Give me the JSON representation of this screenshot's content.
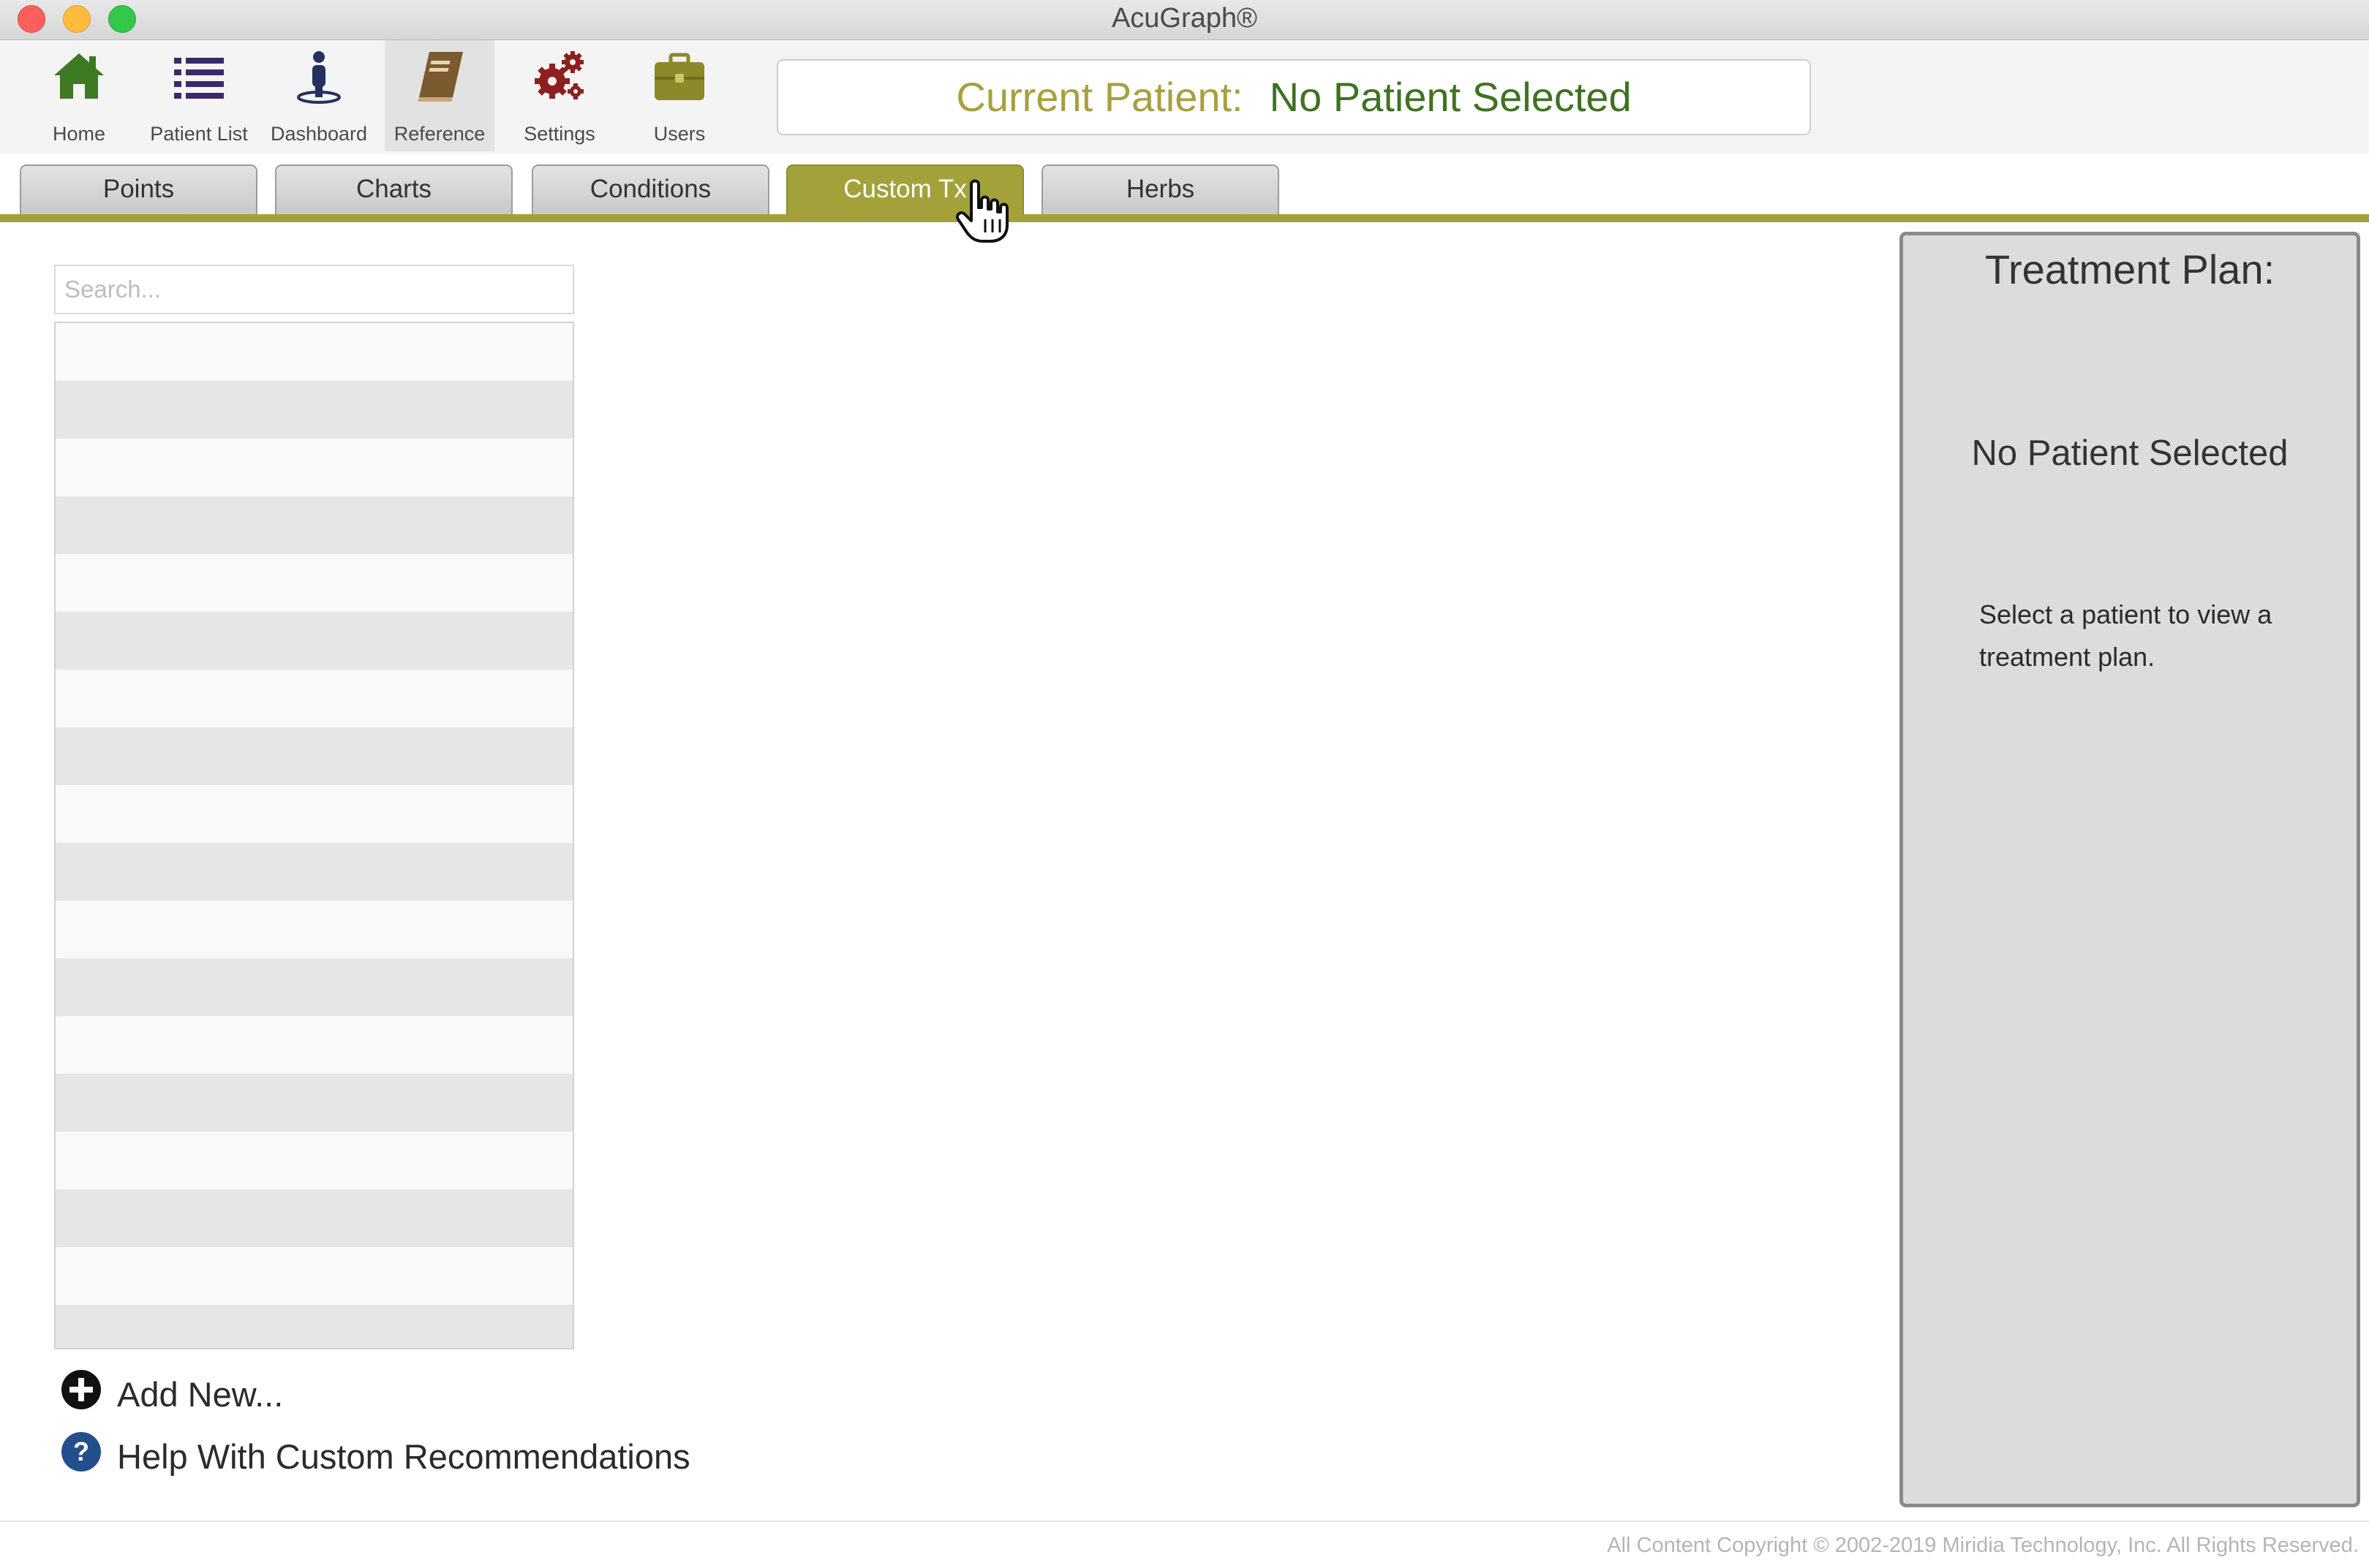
{
  "window": {
    "title": "AcuGraph®"
  },
  "toolbar": {
    "items": [
      {
        "label": "Home",
        "icon": "home-icon",
        "color": "#3d7a22"
      },
      {
        "label": "Patient List",
        "icon": "list-icon",
        "color": "#3b2a6b"
      },
      {
        "label": "Dashboard",
        "icon": "person-icon",
        "color": "#22315f"
      },
      {
        "label": "Reference",
        "icon": "book-icon",
        "color": "#7a5a2e",
        "active": true
      },
      {
        "label": "Settings",
        "icon": "gears-icon",
        "color": "#8e1f1f"
      },
      {
        "label": "Users",
        "icon": "briefcase-icon",
        "color": "#8a8a2a"
      }
    ]
  },
  "current_patient": {
    "label": "Current Patient:",
    "value": "No Patient Selected"
  },
  "tabs": [
    {
      "label": "Points",
      "active": false
    },
    {
      "label": "Charts",
      "active": false
    },
    {
      "label": "Conditions",
      "active": false
    },
    {
      "label": "Custom Tx",
      "active": true
    },
    {
      "label": "Herbs",
      "active": false
    }
  ],
  "search": {
    "placeholder": "Search...",
    "value": ""
  },
  "actions": {
    "add_new": "Add New...",
    "help": "Help With Custom Recommendations"
  },
  "treatment_plan": {
    "title": "Treatment Plan:",
    "patient": "No Patient Selected",
    "hint": "Select a patient to view a treatment plan."
  },
  "footer": {
    "copyright": "All Content Copyright © 2002-2019 Miridia Technology, Inc.  All Rights Reserved."
  },
  "colors": {
    "accent": "#a3a23a",
    "patient_value": "#3e7220",
    "patient_label": "#a7a03d"
  }
}
